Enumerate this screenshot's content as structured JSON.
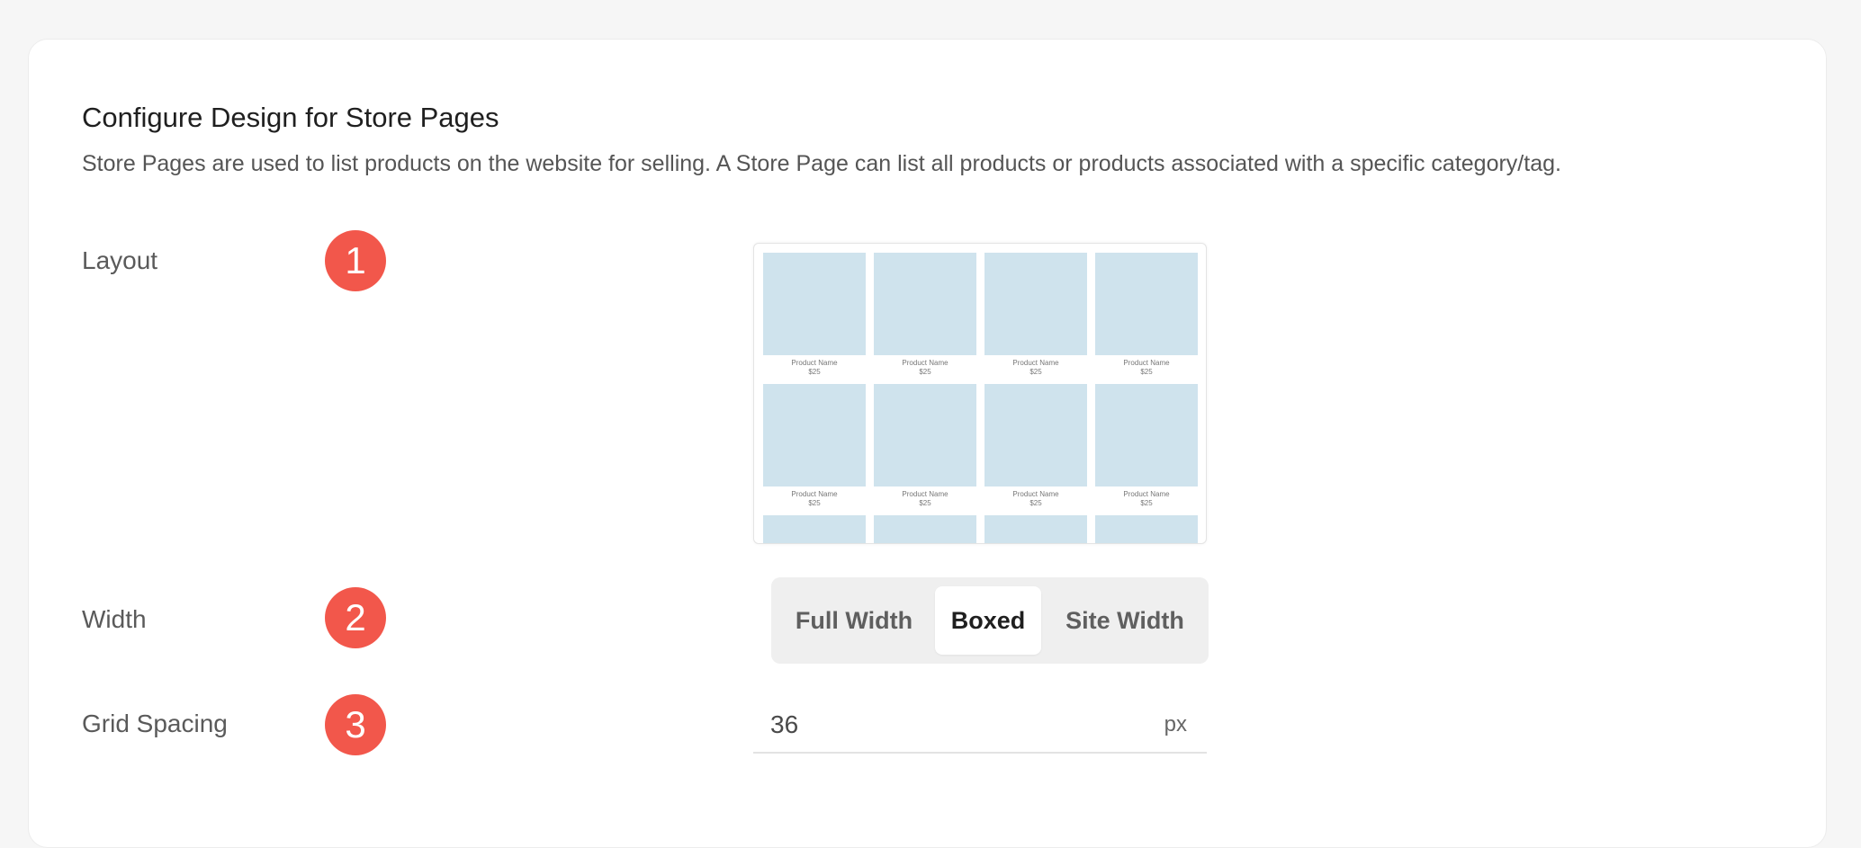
{
  "section": {
    "title": "Configure Design for Store Pages",
    "description": "Store Pages are used to list products on the website for selling. A Store Page can list all products or products associated with a specific category/tag."
  },
  "rows": {
    "layout": {
      "label": "Layout",
      "badge": "1"
    },
    "width": {
      "label": "Width",
      "badge": "2"
    },
    "grid_spacing": {
      "label": "Grid Spacing",
      "badge": "3"
    }
  },
  "preview": {
    "tiles": [
      {
        "name": "Product Name",
        "price": "$25"
      },
      {
        "name": "Product Name",
        "price": "$25"
      },
      {
        "name": "Product Name",
        "price": "$25"
      },
      {
        "name": "Product Name",
        "price": "$25"
      },
      {
        "name": "Product Name",
        "price": "$25"
      },
      {
        "name": "Product Name",
        "price": "$25"
      },
      {
        "name": "Product Name",
        "price": "$25"
      },
      {
        "name": "Product Name",
        "price": "$25"
      }
    ]
  },
  "width_options": {
    "full_width": "Full Width",
    "boxed": "Boxed",
    "site_width": "Site Width",
    "selected": "Boxed"
  },
  "grid_spacing_field": {
    "value": "36",
    "unit": "px"
  },
  "colors": {
    "badge": "#f2574b",
    "tile_placeholder": "#cfe3ed",
    "segmented_bg": "#efefef"
  }
}
